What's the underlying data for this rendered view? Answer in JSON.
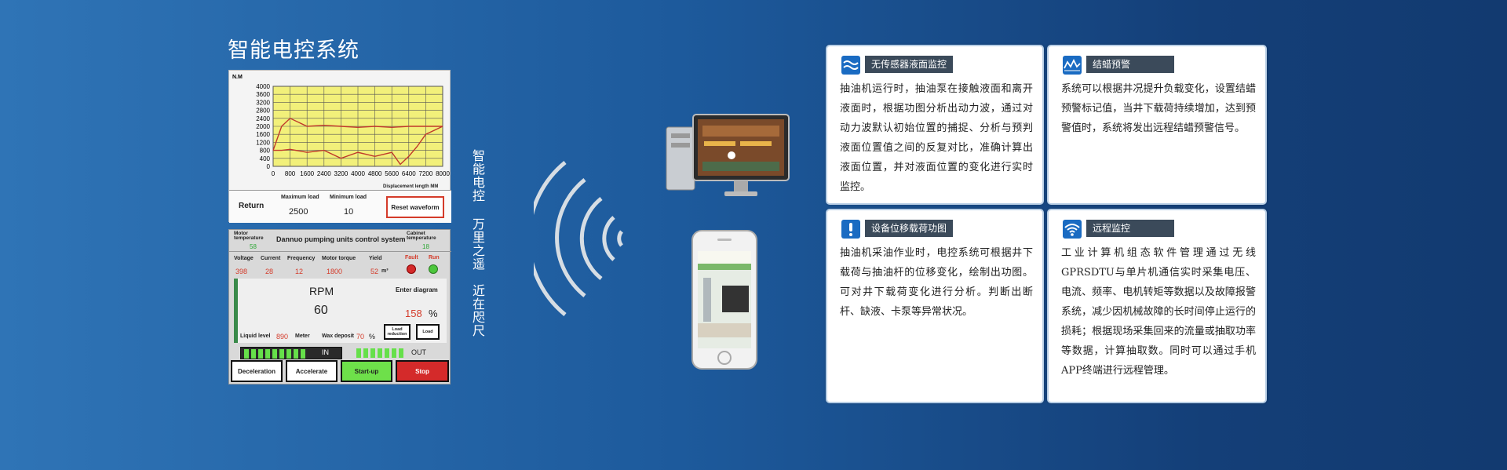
{
  "page": {
    "title": "智能电控系统",
    "vertical_text_1": "智能电控",
    "vertical_text_2": "万里之遥",
    "vertical_text_3": "近在咫尺"
  },
  "chart_panel": {
    "ylabel": "N.M",
    "xlabel": "Displacement length MM",
    "footer": {
      "return_label": "Return",
      "max_load_label": "Maximum load",
      "max_load_value": "2500",
      "min_load_label": "Minimum load",
      "min_load_value": "10",
      "reset_label": "Reset waveform"
    }
  },
  "chart_data": {
    "type": "line",
    "title": "",
    "xlabel": "Displacement length MM",
    "ylabel": "N.M",
    "x_ticks": [
      "0",
      "800",
      "1600",
      "2400",
      "3200",
      "4000",
      "4800",
      "5600",
      "6400",
      "7200",
      "8000"
    ],
    "y_ticks": [
      "4000",
      "3600",
      "3200",
      "2800",
      "2400",
      "2000",
      "1600",
      "1200",
      "800",
      "400",
      "0"
    ],
    "xlim": [
      0,
      8000
    ],
    "ylim": [
      0,
      4000
    ],
    "grid": true,
    "series": [
      {
        "values_x": [
          0,
          400,
          800,
          1600,
          2400,
          3200,
          4000,
          4800,
          5600,
          6400,
          7200,
          8000
        ],
        "values_y": [
          800,
          2000,
          2400,
          2000,
          2050,
          2000,
          1950,
          2000,
          1950,
          2000,
          2000,
          2000
        ]
      },
      {
        "values_x": [
          0,
          400,
          800,
          1600,
          2400,
          3200,
          4000,
          4800,
          5600,
          6000,
          6400,
          6800,
          7200,
          8000
        ],
        "values_y": [
          800,
          800,
          850,
          700,
          800,
          400,
          700,
          500,
          700,
          100,
          500,
          1000,
          1600,
          2000
        ]
      }
    ]
  },
  "control_panel": {
    "motor_temp_label": "Motor temperature",
    "motor_temp_value": "58",
    "title": "Dannuo pumping units control system",
    "cabinet_temp_label": "Cabinet temperature",
    "cabinet_temp_value": "18",
    "metrics": [
      {
        "label": "Voltage",
        "value": "398"
      },
      {
        "label": "Current",
        "value": "28"
      },
      {
        "label": "Frequency",
        "value": "12"
      },
      {
        "label": "Motor torque",
        "value": "1800"
      },
      {
        "label": "Yield",
        "value": "52"
      }
    ],
    "yield_unit": "m³",
    "fault_label": "Fault",
    "run_label": "Run",
    "rpm_label": "RPM",
    "rpm_value": "60",
    "enter_diagram": "Enter diagram",
    "percent_value": "158",
    "percent_sign": "%",
    "liquid_level_label": "Liquid level",
    "liquid_level_value": "890",
    "meter_label": "Meter",
    "wax_label": "Wax deposit",
    "wax_value": "70",
    "wax_unit": "%",
    "load_reduction_label": "Load reduction",
    "load_label": "Load",
    "in_label": "IN",
    "out_label": "OUT",
    "buttons": {
      "deceleration": "Deceleration",
      "accelerate": "Accelerate",
      "startup": "Start-up",
      "stop": "Stop"
    }
  },
  "cards": [
    {
      "tag": "无传感器液面监控",
      "icon": "wave-icon",
      "text": "抽油机运行时，抽油泵在接触液面和离开液面时，根据功图分析出动力波，通过对动力波默认初始位置的捕捉、分析与预判液面位置值之间的反复对比，准确计算出液面位置，并对液面位置的变化进行实时监控。"
    },
    {
      "tag": "结蜡预警",
      "icon": "waveform-icon",
      "text": "系统可以根据井况提升负载变化，设置结蜡预警标记值，当井下载荷持续增加，达到预警值时，系统将发出远程结蜡预警信号。"
    },
    {
      "tag": "设备位移载荷功图",
      "icon": "exclamation-icon",
      "text": "抽油机采油作业时，电控系统可根据井下载荷与抽油杆的位移变化，绘制出功图。可对井下载荷变化进行分析。判断出断杆、缺液、卡泵等异常状况。"
    },
    {
      "tag": "远程监控",
      "icon": "wifi-icon",
      "text": "工业计算机组态软件管理通过无线GPRSDTU与单片机通信实时采集电压、电流、频率、电机转矩等数据以及故障报警系统，减少因机械故障的长时间停止运行的损耗；根据现场采集回来的流量或抽取功率等数据，计算抽取数。同时可以通过手机APP终端进行远程管理。"
    }
  ],
  "colors": {
    "accent": "#1a6bc2",
    "alarm_red": "#d43b2a",
    "ok_green": "#4cc63c",
    "chart_bg": "#f2f07a"
  }
}
